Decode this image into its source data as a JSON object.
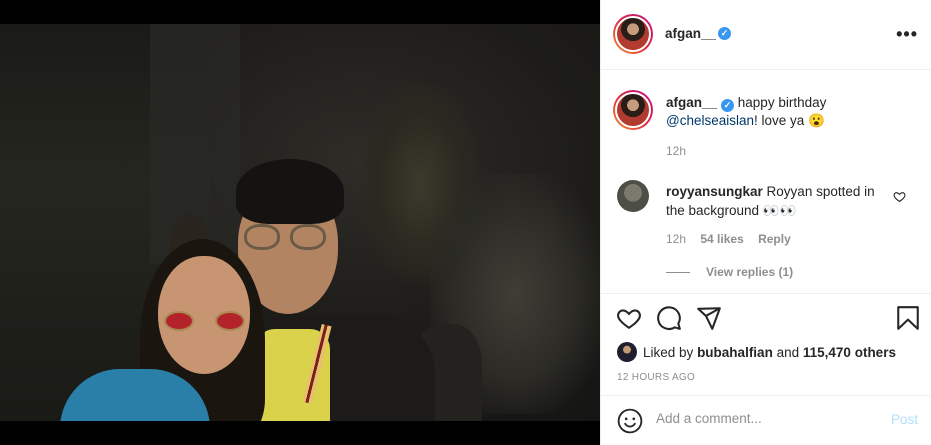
{
  "post": {
    "username": "afgan__",
    "verified_mark": "✓",
    "more_label": "•••",
    "caption": {
      "username": "afgan__",
      "text_before": " happy birthday",
      "mention": "@chelseaislan",
      "text_after": "! love ya 😮",
      "time": "12h"
    },
    "comment": {
      "username": "royyansungkar",
      "text": " Royyan spotted in the background 👀👀",
      "time": "12h",
      "likes": "54 likes",
      "reply_label": "Reply",
      "view_replies": "View replies (1)"
    },
    "likes": {
      "prefix": "Liked by ",
      "liker": "bubahalfian",
      "middle": " and ",
      "count": "115,470 others"
    },
    "time_ago": "12 HOURS AGO",
    "add_comment": {
      "placeholder": "Add a comment...",
      "post_label": "Post"
    }
  },
  "icons": {
    "like": "heart-icon",
    "comment": "comment-icon",
    "share": "share-icon",
    "save": "bookmark-icon",
    "emoji": "emoji-icon"
  },
  "colors": {
    "verified": "#3897f0",
    "mention": "#00376b",
    "muted": "#8e8e8e",
    "post_disabled": "#b2dffc"
  }
}
